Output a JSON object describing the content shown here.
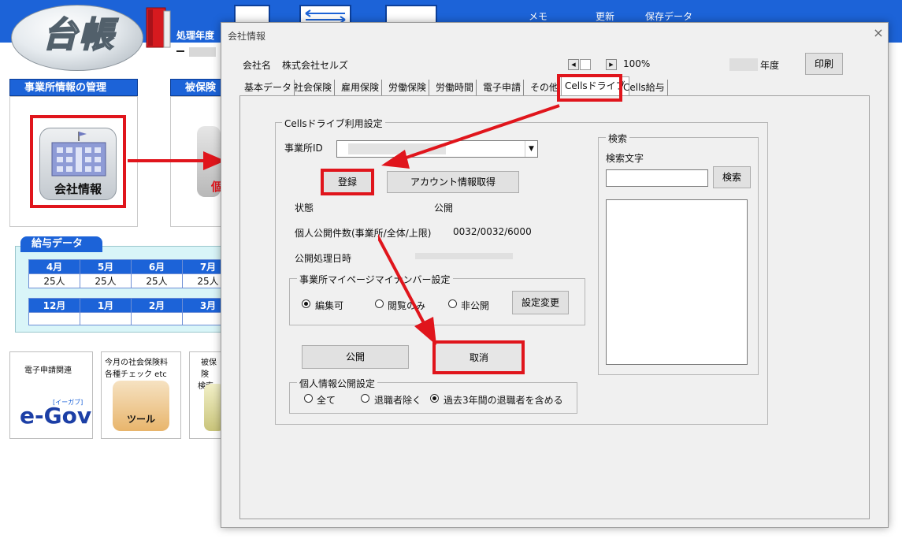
{
  "app": {
    "logo": "台帳",
    "header": {
      "fiscal_label": "処理年度"
    },
    "top_menu": [
      "メモ",
      "更新",
      "保存データ"
    ],
    "sections": {
      "office": "事業所情報の管理",
      "insured": "被保険者"
    },
    "company_button": "会社情報",
    "salary_title": "給与データ",
    "months_row1": [
      "4月",
      "5月",
      "6月",
      "7月"
    ],
    "counts_row1": [
      "25人",
      "25人",
      "25人",
      "25人"
    ],
    "months_row2": [
      "12月",
      "1月",
      "2月",
      "3月"
    ],
    "tiles": {
      "egov_caption": "電子申請関連",
      "egov_logo": "e-Gov",
      "egov_kana": "[イーガブ]",
      "tool_caption_1": "今月の社会保険料",
      "tool_caption_2": "各種チェック etc",
      "tool_label": "ツール",
      "insured_caption_1": "被保険",
      "insured_caption_2": "検索・"
    }
  },
  "dialog": {
    "title": "会社情報",
    "close": "×",
    "company_label": "会社名",
    "company_name": "株式会社セルズ",
    "zoom": "100%",
    "year_suffix": "年度",
    "print_button": "印刷",
    "tabs": [
      "基本データ",
      "社会保険",
      "雇用保険",
      "労働保険",
      "労働時間",
      "電子申請",
      "その他",
      "Cellsドライブ",
      "Cells給与"
    ],
    "active_tab": "Cellsドライブ",
    "cells": {
      "group_title": "Cellsドライブ利用設定",
      "office_id_label": "事業所ID",
      "register_button": "登録",
      "account_button": "アカウント情報取得",
      "status_label": "状態",
      "status_value": "公開",
      "count_label": "個人公開件数(事業所/全体/上限)",
      "count_value": "0032/0032/6000",
      "date_label": "公開処理日時",
      "mypage_group": "事業所マイページマイナンバー設定",
      "mypage_options": [
        "編集可",
        "閲覧のみ",
        "非公開"
      ],
      "mypage_selected": "編集可",
      "settings_button": "設定変更",
      "publish_button": "公開",
      "cancel_button": "取消",
      "personal_group": "個人情報公開設定",
      "personal_options": [
        "全て",
        "退職者除く",
        "過去3年間の退職者を含める"
      ],
      "personal_selected": "過去3年間の退職者を含める"
    },
    "search": {
      "group_title": "検索",
      "label": "検索文字",
      "input_value": "",
      "button": "検索"
    }
  },
  "colors": {
    "brand_blue": "#1c63d8",
    "highlight_red": "#e0151c",
    "dialog_bg": "#f0f0f0"
  }
}
